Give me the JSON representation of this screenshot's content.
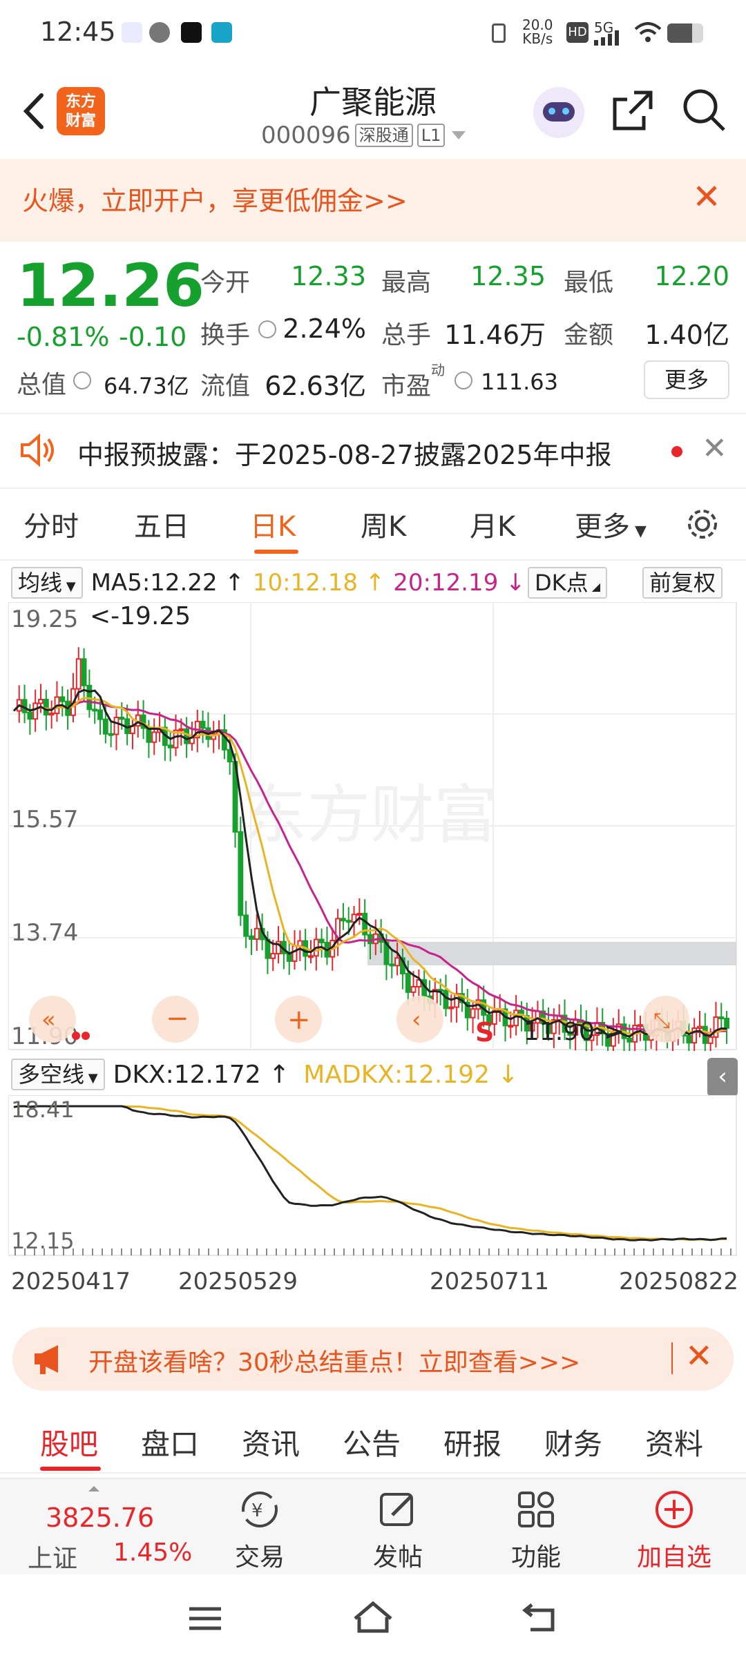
{
  "status_bar": {
    "time": "12:45",
    "net_speed_top": "20.0",
    "net_speed_unit": "KB/s",
    "signal": "5G"
  },
  "header": {
    "logo_text_1": "东方",
    "logo_text_2": "财富",
    "stock_name": "广聚能源",
    "stock_code": "000096",
    "market_tag": "深股通",
    "level_tag": "L1"
  },
  "promo_banner": {
    "text": "火爆，立即开户，享更低佣金>>"
  },
  "quote": {
    "price": "12.26",
    "change_pct": "-0.81%",
    "change": "-0.10",
    "open_label": "今开",
    "open": "12.33",
    "high_label": "最高",
    "high": "12.35",
    "low_label": "最低",
    "low": "12.20",
    "turnover_label": "换手",
    "turnover": "2.24%",
    "volume_label": "总手",
    "volume": "11.46万",
    "amount_label": "金额",
    "amount": "1.40亿",
    "mktcap_label": "总值",
    "mktcap": "64.73亿",
    "float_label": "流值",
    "float": "62.63亿",
    "pe_label": "市盈",
    "pe_sup": "动",
    "pe": "111.63",
    "more_label": "更多"
  },
  "notice": {
    "text": "中报预披露：于2025-08-27披露2025年中报"
  },
  "chart_tabs": [
    "分时",
    "五日",
    "日K",
    "周K",
    "月K",
    "更多"
  ],
  "ma_legend": {
    "selector": "均线",
    "ma5": "MA5:12.22 ↑",
    "ma10": "10:12.18 ↑",
    "ma20": "20:12.19 ↓",
    "dk_btn": "DK点",
    "adj_btn": "前复权"
  },
  "dkx_legend": {
    "selector": "多空线",
    "dkx": "DKX:12.172 ↑",
    "madkx": "MADKX:12.192 ↓"
  },
  "chart_data": [
    {
      "type": "candlestick",
      "y_ticks": [
        "19.25",
        "15.57",
        "13.74",
        "11.90"
      ],
      "ylim": [
        11.9,
        19.25
      ],
      "annotations": [
        "<-19.25",
        "11.90->",
        "S"
      ],
      "watermark": "东方财富",
      "series": [
        {
          "name": "MA5",
          "color": "#222222"
        },
        {
          "name": "10",
          "color": "#e8b423"
        },
        {
          "name": "20",
          "color": "#c8238a"
        }
      ]
    },
    {
      "type": "line",
      "y_ticks": [
        "18.41",
        "12.15"
      ],
      "ylim": [
        12.15,
        18.41
      ],
      "series": [
        {
          "name": "DKX",
          "color": "#222222"
        },
        {
          "name": "MADKX",
          "color": "#e8b423"
        }
      ]
    }
  ],
  "x_dates": [
    "20250417",
    "20250529",
    "20250711",
    "20250822"
  ],
  "promo2": {
    "text": "开盘该看啥？30秒总结重点！立即查看>>>"
  },
  "bottom_tabs": [
    "股吧",
    "盘口",
    "资讯",
    "公告",
    "研报",
    "财务",
    "资料"
  ],
  "footer": {
    "index_value": "3825.76",
    "index_name": "上证",
    "index_change": "1.45%",
    "trade": "交易",
    "post": "发帖",
    "func": "功能",
    "add_watch": "加自选"
  },
  "colors": {
    "up": "#e8262a",
    "down": "#16a02e",
    "accent": "#f2631c"
  }
}
